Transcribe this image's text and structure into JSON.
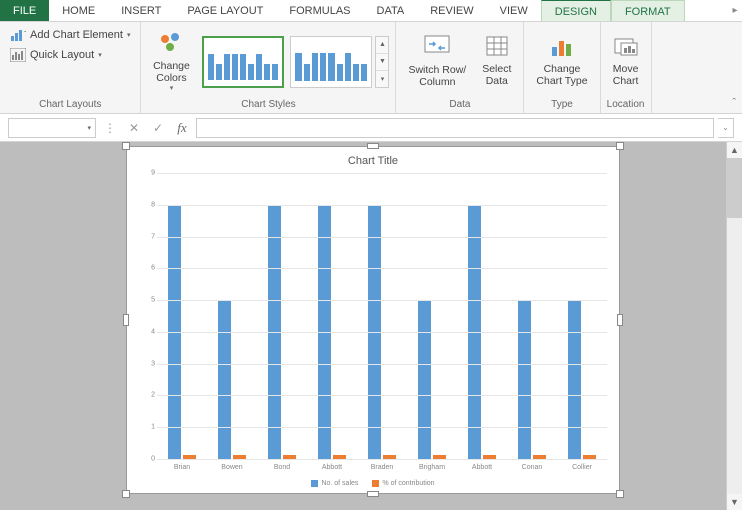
{
  "tabs": {
    "file": "FILE",
    "home": "HOME",
    "insert": "INSERT",
    "page_layout": "PAGE LAYOUT",
    "formulas": "FORMULAS",
    "data": "DATA",
    "review": "REVIEW",
    "view": "VIEW",
    "design": "DESIGN",
    "format": "FORMAT"
  },
  "ribbon": {
    "layouts": {
      "add_element": "Add Chart Element",
      "quick_layout": "Quick Layout",
      "group": "Chart Layouts"
    },
    "colors": {
      "change": "Change\nColors",
      "group": "Chart Styles"
    },
    "data": {
      "switch": "Switch Row/\nColumn",
      "select": "Select\nData",
      "group": "Data"
    },
    "type": {
      "change": "Change\nChart Type",
      "group": "Type"
    },
    "location": {
      "move": "Move\nChart",
      "group": "Location"
    }
  },
  "formula_bar": {
    "name_box": ""
  },
  "chart": {
    "title": "Chart Title",
    "legend": {
      "s1": "No. of sales",
      "s2": "% of contribution"
    }
  },
  "chart_data": {
    "type": "bar",
    "title": "Chart Title",
    "xlabel": "",
    "ylabel": "",
    "ylim": [
      0,
      9
    ],
    "yticks": [
      0,
      1,
      2,
      3,
      4,
      5,
      6,
      7,
      8,
      9
    ],
    "categories": [
      "Brian",
      "Bowen",
      "Bond",
      "Abbott",
      "Braden",
      "Brigham",
      "Abbott",
      "Conan",
      "Collier"
    ],
    "series": [
      {
        "name": "No. of sales",
        "values": [
          8,
          5,
          8,
          8,
          8,
          5,
          8,
          5,
          5
        ],
        "color": "#5b9bd5"
      },
      {
        "name": "% of contribution",
        "values": [
          0.12,
          0.12,
          0.12,
          0.12,
          0.12,
          0.12,
          0.12,
          0.12,
          0.12
        ],
        "color": "#ed7d31"
      }
    ]
  }
}
